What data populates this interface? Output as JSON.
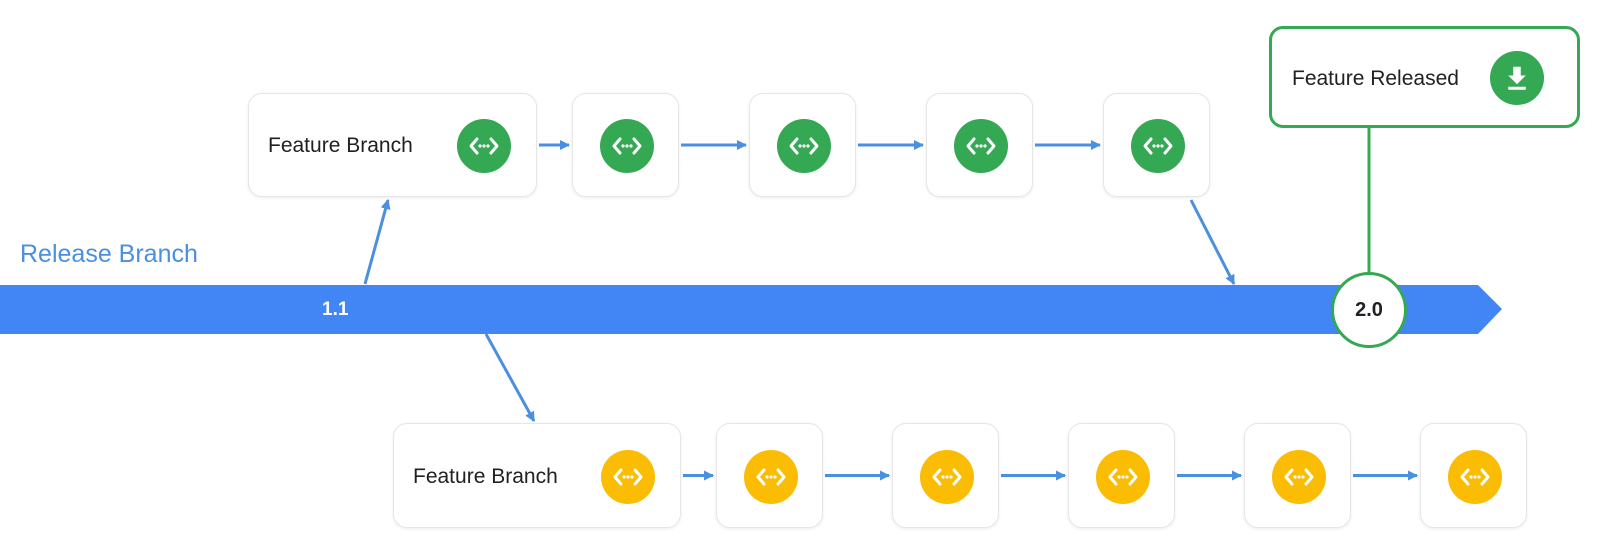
{
  "release_branch": {
    "label": "Release Branch",
    "start_version": "1.1",
    "end_version": "2.0"
  },
  "top_branch": {
    "label": "Feature Branch",
    "commit_count": 5,
    "icon": "code-commit-icon",
    "color": "#34a853"
  },
  "bottom_branch": {
    "label": "Feature Branch",
    "commit_count": 6,
    "icon": "code-commit-icon",
    "color": "#fbbc04"
  },
  "release": {
    "label": "Feature Released",
    "icon": "download-icon",
    "color": "#34a853"
  },
  "colors": {
    "branch": "#4285f4",
    "arrow": "#4a8fe0"
  }
}
